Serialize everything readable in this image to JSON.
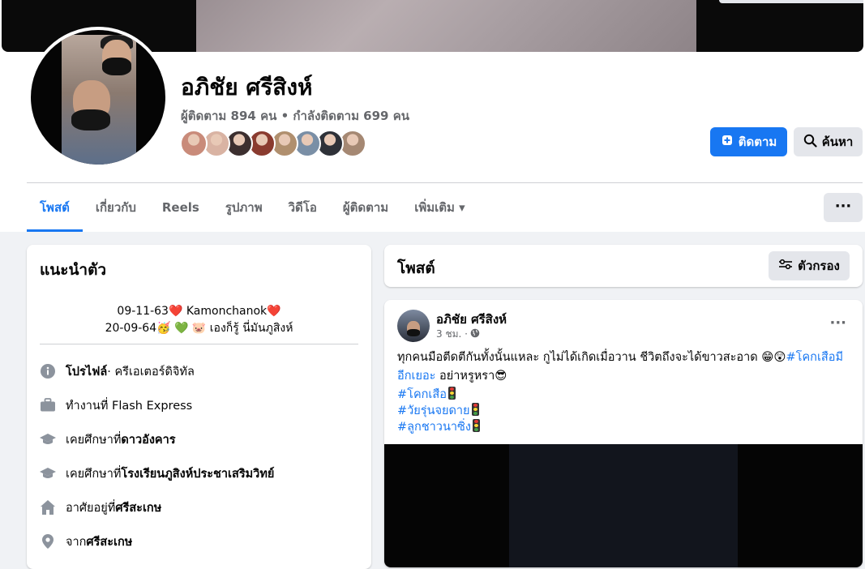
{
  "profile": {
    "name": "อภิชัย ศรีสิงห์",
    "followers_line": "ผู้ติดตาม 894 คน • กำลังติดตาม 699 คน",
    "friend_avatar_colors": [
      "#c98b7a",
      "#d9b3a3",
      "#3c2f2f",
      "#8a3b2f",
      "#b08f6e",
      "#7a8fa6",
      "#2e3138",
      "#a58873"
    ]
  },
  "actions": {
    "follow_label": "ติดตาม",
    "search_label": "ค้นหา"
  },
  "tabs": [
    {
      "label": "โพสต์"
    },
    {
      "label": "เกี่ยวกับ"
    },
    {
      "label": "Reels"
    },
    {
      "label": "รูปภาพ"
    },
    {
      "label": "วิดีโอ"
    },
    {
      "label": "ผู้ติดตาม"
    },
    {
      "label": "เพิ่มเติม ▾"
    }
  ],
  "intro": {
    "title": "แนะนำตัว",
    "bio_line1": "09-11-63❤️ Kamonchanok❤️",
    "bio_line2": "20-09-64🥳 💚 🐷 เองก็รู้ นี่มันภูสิงห์",
    "rows": [
      {
        "icon": "info-icon",
        "bold": "โปรไฟล์",
        "text": " · ครีเอเตอร์ดิจิทัล"
      },
      {
        "icon": "briefcase-icon",
        "text": "ทำงานที่ Flash Express",
        "bold": ""
      },
      {
        "icon": "graduation-cap-icon",
        "text": "เคยศึกษาที่ ",
        "bold": "ดาวอังคาร"
      },
      {
        "icon": "graduation-cap-icon",
        "text": "เคยศึกษาที่ ",
        "bold": "โรงเรียนภูสิงห์ประชาเสริมวิทย์"
      },
      {
        "icon": "home-icon",
        "text": "อาศัยอยู่ที่ ",
        "bold": "ศรีสะเกษ"
      },
      {
        "icon": "location-pin-icon",
        "text": "จาก ",
        "bold": "ศรีสะเกษ"
      }
    ]
  },
  "posts_header": {
    "title": "โพสต์",
    "filter_label": "ตัวกรอง"
  },
  "post": {
    "author": "อภิชัย ศรีสิงห์",
    "time": "3 ชม. ·",
    "text_main": "ทุกคนมือตีดตีกันทั้งนั้นแหละ กูไม่ได้เกิดเมื่อวาน ชีวิตถึงจะได้ขาวสะอาด 😁😲",
    "text_tag": "#โคกเสือมีอีกเยอะ",
    "text_tail": " อย่าหรูหรา😎",
    "tags": [
      "#โคกเสือ",
      "#วัยรุ่นจยดาย",
      "#ลูกชาวนาซิ่ง"
    ]
  }
}
